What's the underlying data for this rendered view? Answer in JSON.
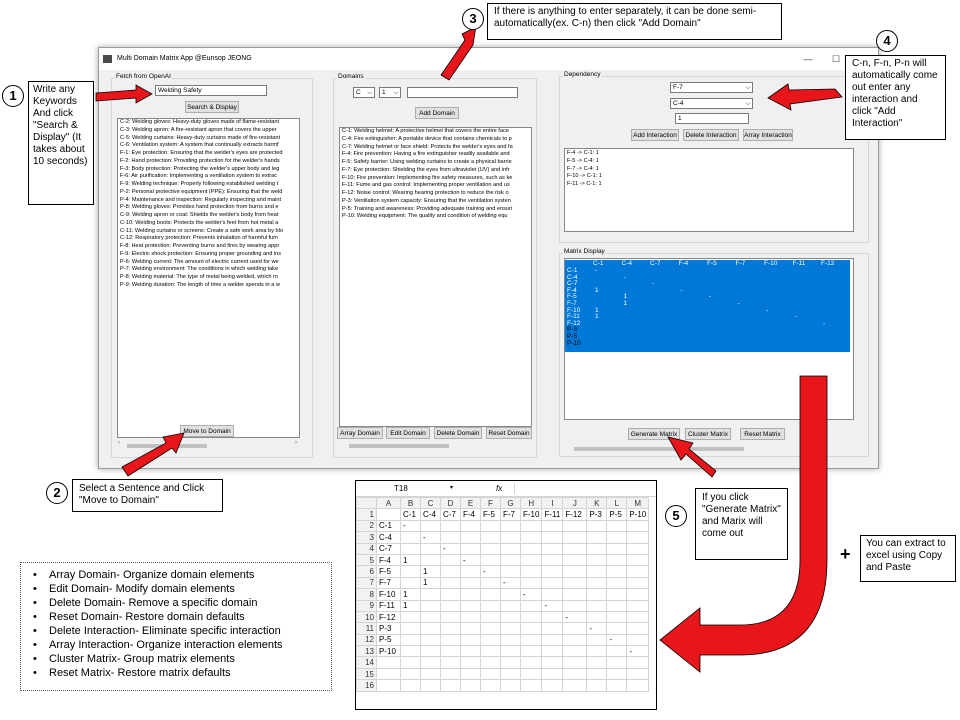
{
  "window": {
    "title": "Multi Domain Matrix App @Eunsop JEONG",
    "minimize": "—",
    "maximize": "☐",
    "close": "✕"
  },
  "fetch": {
    "frame_label": "Fetch from OpenAI",
    "keyword_value": "Welding Safety",
    "search_button": "Search & Display",
    "sentences": [
      "C-2: Welding gloves: Heavy-duty gloves made of flame-resistant",
      "C-3: Welding apron: A fire-resistant apron that covers the upper",
      "C-5: Welding curtains: Heavy-duty curtains made of fire-resistant",
      "C-6: Ventilation system: A system that continually extracts harmf",
      "F-1: Eye protection: Ensuring that the welder's eyes are protected",
      "F-2: Hand protection: Providing protection for the welder's hands",
      "F-3: Body protection: Protecting the welder's upper body and leg",
      "F-6: Air purification: Implementing a ventilation system to extrac",
      "F-9: Welding technique: Properly following established welding t",
      "P-2: Personal protective equipment (PPE): Ensuring that the weld",
      "P-4: Maintenance and inspection: Regularly inspecting and maint",
      "P-8: Welding gloves: Provides hand protection from burns and e",
      "C-9: Welding apron or coat: Shields the welder's body from heat",
      "C-10: Welding boots: Protects the welder's feet from hot metal a",
      "C-11: Welding curtains or screens: Create a safe work area by blo",
      "C-12: Respiratory protection: Prevents inhalation of harmful fum",
      "F-8: Heat protection: Preventing burns and fires by wearing appr",
      "F-9: Electric shock protection: Ensuring proper grounding and ins",
      "P-6: Welding current: The amount of electric current used for we",
      "P-7: Welding environment: The conditions in which welding take",
      "P-8: Welding material: The type of metal being welded, which m",
      "P-9: Welding duration: The length of time a welder spends in a w"
    ],
    "move_button": "Move to Domain"
  },
  "domains": {
    "frame_label": "Domains",
    "type_value": "C",
    "num_value": "1",
    "text_value": "",
    "add_button": "Add Domain",
    "items": [
      "C-1: Welding helmet: A protective helmet that covers the entire face",
      "C-4: Fire extinguisher: A portable device that contains chemicals to p",
      "C-7: Welding helmet or face shield: Protects the welder's eyes and fa",
      "F-4: Fire prevention: Having a fire extinguisher readily available and",
      "F-5: Safety barrier: Using welding curtains to create a physical barrie",
      "F-7: Eye protection: Shielding the eyes from ultraviolet (UV) and infr",
      "F-10: Fire prevention: Implementing fire safety measures, such as ke",
      "F-11: Fume and gas control: Implementing proper ventilation and us",
      "F-12: Noise control: Wearing hearing protection to reduce the risk o",
      "P-3: Ventilation system capacity: Ensuring that the ventilation systen",
      "P-5: Training and awareness: Providing adequate training and ensuri",
      "P-10: Welding equipment: The quality and condition of welding equ"
    ],
    "buttons": [
      "Array Domain",
      "Edit Domain",
      "Delete Domain",
      "Reset Domain"
    ]
  },
  "dependency": {
    "frame_label": "Dependency",
    "from_value": "F-7",
    "to_value": "C-4",
    "weight_value": "1",
    "buttons": [
      "Add Interaction",
      "Delete Interaction",
      "Array Interaction"
    ],
    "items": [
      "F-4 -> C-1: 1",
      "F-5 -> C-4: 1",
      "F-7 -> C-4: 1",
      "F-10 -> C-1: 1",
      "F-11 -> C-1: 1"
    ]
  },
  "matrix": {
    "frame_label": "Matrix Display",
    "cols": [
      "C-1",
      "C-4",
      "C-7",
      "F-4",
      "F-5",
      "F-7",
      "F-10",
      "F-11",
      "F-12"
    ],
    "rows": [
      "C-1",
      "C-4",
      "C-7",
      "F-4",
      "F-5",
      "F-7",
      "F-10",
      "F-11",
      "F-12",
      "P-3",
      "P-5",
      "P-10"
    ],
    "buttons": [
      "Generate Matrix",
      "Cluster Matrix",
      "Reset Matrix"
    ],
    "highlight_color": "#0078d7"
  },
  "callouts": {
    "c1": {
      "num": "1",
      "text": "Write any Keywords And click \"Search & Display\" (It takes about 10 seconds)"
    },
    "c2": {
      "num": "2",
      "text": "Select a Sentence and Click \"Move to Domain\""
    },
    "c3": {
      "num": "3",
      "text": "If there is anything to enter separately, it can be done semi-automatically(ex. C-n) then click \"Add Domain\""
    },
    "c4": {
      "num": "4",
      "text": "C-n, F-n, P-n will automatically come out enter any interaction and click \"Add Interaction\""
    },
    "c5": {
      "num": "5",
      "text": "If you click \"Generate Matrix\" and Marix will come out"
    },
    "c6": {
      "plus": "+",
      "text": "You can extract to excel using Copy and Paste"
    }
  },
  "legend": [
    "Array Domain- Organize domain elements",
    "Edit Domain- Modify domain elements",
    "Delete Domain- Remove a specific domain",
    "Reset Domain- Restore domain defaults",
    "Delete Interaction- Eliminate specific interaction",
    "Array Interaction- Organize interaction elements",
    "Cluster Matrix- Group matrix elements",
    "Reset Matrix- Restore matrix defaults"
  ],
  "excel": {
    "name_box": "T18",
    "fx": "fx",
    "col_letters": [
      "A",
      "B",
      "C",
      "D",
      "E",
      "F",
      "G",
      "H",
      "I",
      "J",
      "K",
      "L",
      "M"
    ],
    "header_row": [
      "",
      "C-1",
      "C-4",
      "C-7",
      "F-4",
      "F-5",
      "F-7",
      "F-10",
      "F-11",
      "F-12",
      "P-3",
      "P-5",
      "P-10"
    ],
    "rows": [
      [
        "C-1",
        "-",
        "",
        "",
        "",
        "",
        "",
        "",
        "",
        "",
        "",
        "",
        ""
      ],
      [
        "C-4",
        "",
        "-",
        "",
        "",
        "",
        "",
        "",
        "",
        "",
        "",
        "",
        ""
      ],
      [
        "C-7",
        "",
        "",
        "-",
        "",
        "",
        "",
        "",
        "",
        "",
        "",
        "",
        ""
      ],
      [
        "F-4",
        "1",
        "",
        "",
        "-",
        "",
        "",
        "",
        "",
        "",
        "",
        "",
        ""
      ],
      [
        "F-5",
        "",
        "1",
        "",
        "",
        "-",
        "",
        "",
        "",
        "",
        "",
        "",
        ""
      ],
      [
        "F-7",
        "",
        "1",
        "",
        "",
        "",
        "-",
        "",
        "",
        "",
        "",
        "",
        ""
      ],
      [
        "F-10",
        "1",
        "",
        "",
        "",
        "",
        "",
        "-",
        "",
        "",
        "",
        "",
        ""
      ],
      [
        "F-11",
        "1",
        "",
        "",
        "",
        "",
        "",
        "",
        "-",
        "",
        "",
        "",
        ""
      ],
      [
        "F-12",
        "",
        "",
        "",
        "",
        "",
        "",
        "",
        "",
        "-",
        "",
        "",
        ""
      ],
      [
        "P-3",
        "",
        "",
        "",
        "",
        "",
        "",
        "",
        "",
        "",
        "-",
        "",
        ""
      ],
      [
        "P-5",
        "",
        "",
        "",
        "",
        "",
        "",
        "",
        "",
        "",
        "",
        "-",
        ""
      ],
      [
        "P-10",
        "",
        "",
        "",
        "",
        "",
        "",
        "",
        "",
        "",
        "",
        "",
        "-"
      ],
      [
        "",
        "",
        "",
        "",
        "",
        "",
        "",
        "",
        "",
        "",
        "",
        "",
        ""
      ],
      [
        "",
        "",
        "",
        "",
        "",
        "",
        "",
        "",
        "",
        "",
        "",
        "",
        ""
      ],
      [
        "",
        "",
        "",
        "",
        "",
        "",
        "",
        "",
        "",
        "",
        "",
        "",
        ""
      ]
    ]
  }
}
